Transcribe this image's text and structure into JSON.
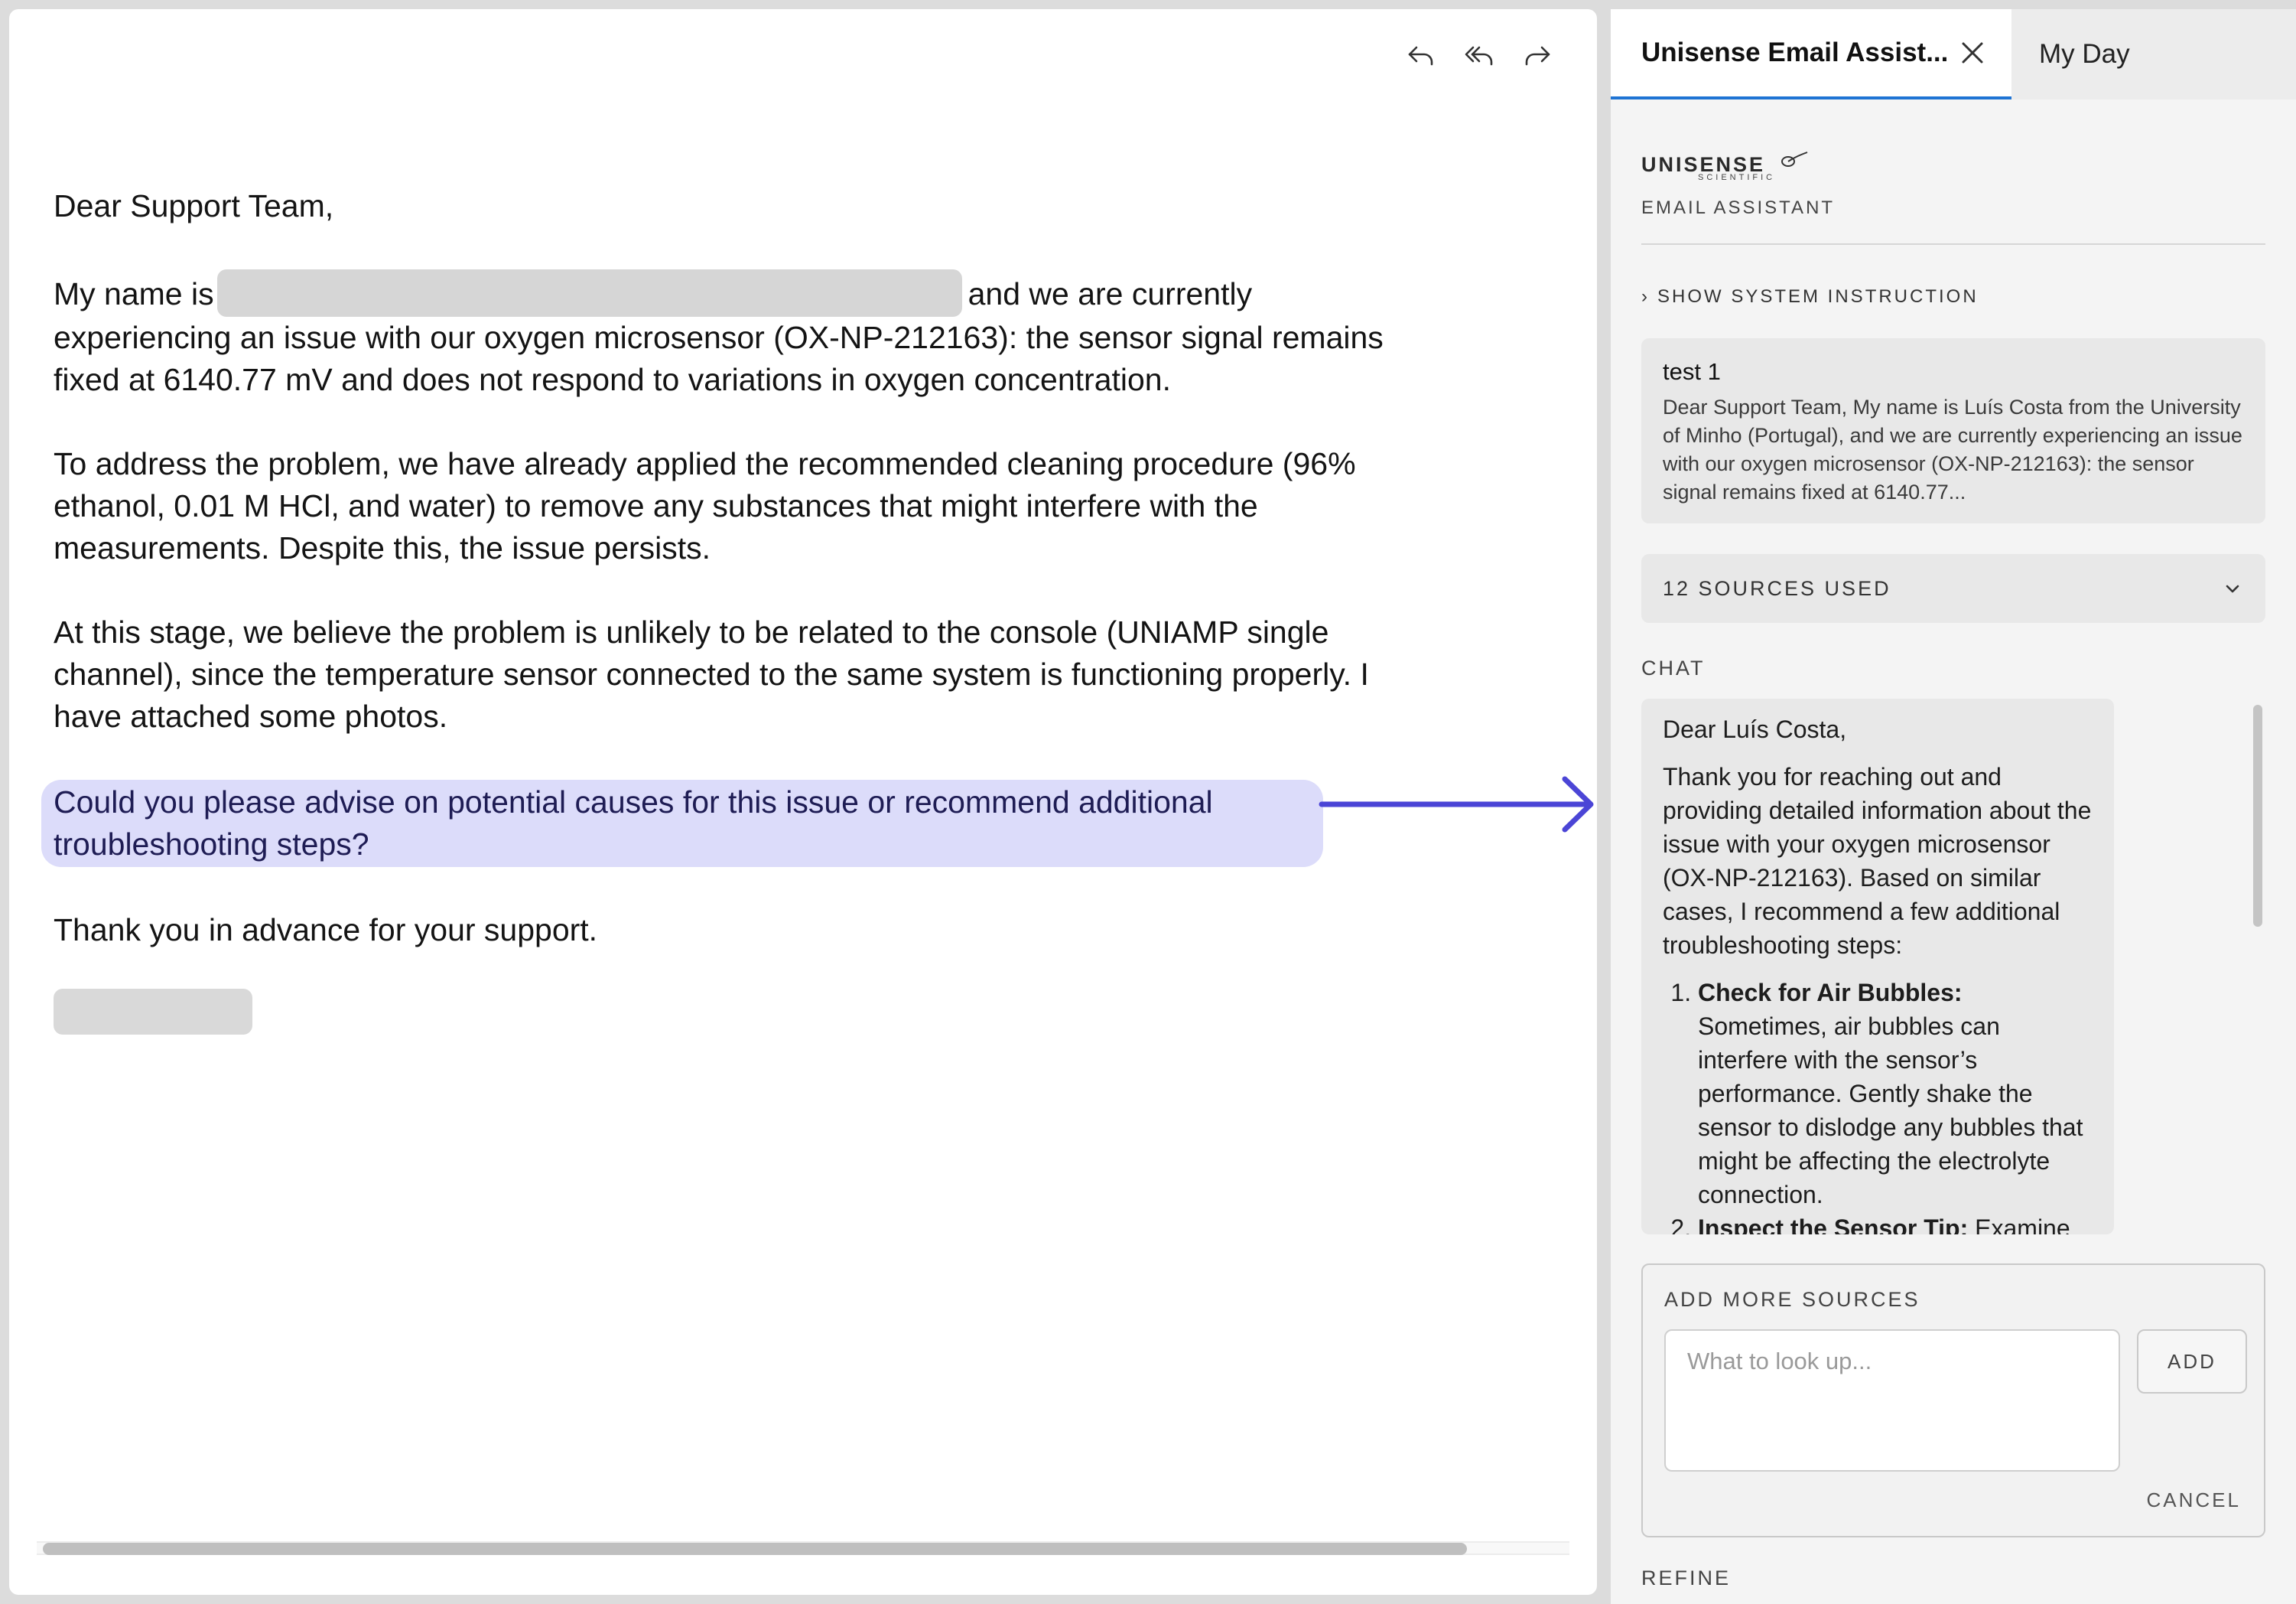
{
  "email": {
    "greeting": "Dear Support Team,",
    "p1_start": "My name is",
    "p1_end": "and we are currently experiencing an issue with our oxygen microsensor (OX-NP-212163): the sensor signal remains fixed at 6140.77 mV and does not respond to variations in oxygen concentration.",
    "p2": "To address the problem, we have already applied the recommended cleaning procedure (96% ethanol, 0.01 M HCl, and water) to remove any substances that might interfere with the measurements. Despite this, the issue persists.",
    "p3": "At this stage, we believe the problem is unlikely to be related to the console (UNIAMP single channel), since the temperature sensor connected to the same system is functioning properly. I have attached some photos.",
    "highlighted": "Could you please advise on potential causes for this issue or recommend additional troubleshooting steps?",
    "closing": "Thank you in advance for your support."
  },
  "colors": {
    "highlight_bg": "#dcdcfa",
    "arrow": "#4b45d6",
    "tab_accent": "#1f74d4"
  },
  "tabs": {
    "active_label": "Unisense Email Assist...",
    "inactive_label": "My Day"
  },
  "brand": {
    "name": "UNISENSE",
    "sub": "SCIENTIFIC",
    "caption": "EMAIL ASSISTANT"
  },
  "instruction_toggle": "SHOW SYSTEM INSTRUCTION",
  "test_card": {
    "title": "test 1",
    "excerpt": " Dear Support Team,  My name is Luís Costa from the University of Minho (Portugal), and we are currently experiencing an issue with our oxygen microsensor (OX-NP-212163): the sensor signal remains fixed at 6140.77..."
  },
  "sources": {
    "label": "12 SOURCES USED"
  },
  "chat": {
    "label": "CHAT",
    "salutation": "Dear Luís Costa,",
    "intro": "Thank you for reaching out and providing detailed information about the issue with your oxygen microsensor (OX-NP-212163). Based on similar cases, I recommend a few additional troubleshooting steps:",
    "steps": [
      {
        "title": "Check for Air Bubbles:",
        "body": "Sometimes, air bubbles can interfere with the sensor’s performance. Gently shake the sensor to dislodge any bubbles that might be affecting the electrolyte connection."
      },
      {
        "title": "Inspect the Sensor Tip:",
        "body": "Examine the sensor tip"
      }
    ]
  },
  "add_sources": {
    "label": "ADD MORE SOURCES",
    "placeholder": "What to look up...",
    "value": "",
    "add_label": "ADD",
    "cancel_label": "CANCEL"
  },
  "refine_label": "REFINE"
}
